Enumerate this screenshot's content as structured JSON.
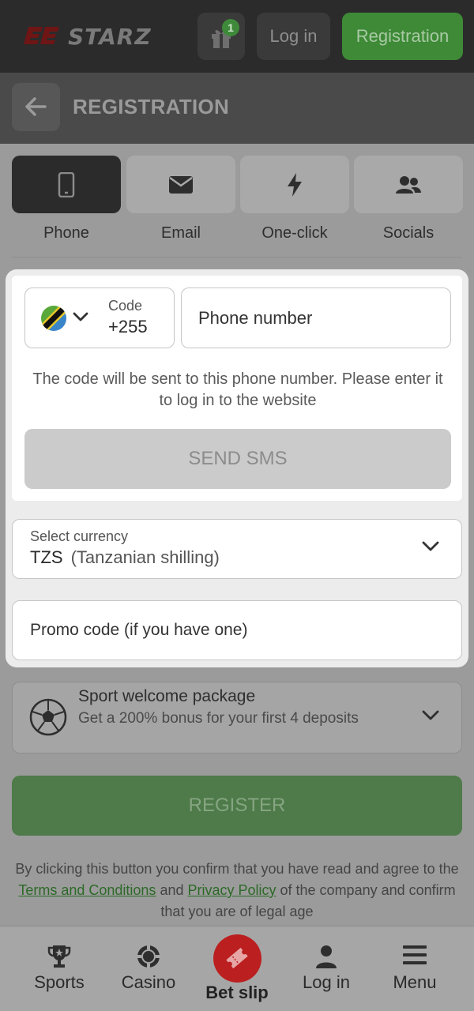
{
  "header": {
    "brand": "STARZ",
    "gift_badge": "1",
    "login_label": "Log in",
    "register_label": "Registration"
  },
  "titlebar": {
    "title": "REGISTRATION"
  },
  "tabs": [
    {
      "label": "Phone",
      "icon": "phone-icon",
      "active": true
    },
    {
      "label": "Email",
      "icon": "envelope-icon",
      "active": false
    },
    {
      "label": "One-click",
      "icon": "lightning-icon",
      "active": false
    },
    {
      "label": "Socials",
      "icon": "users-icon",
      "active": false
    }
  ],
  "phone_form": {
    "code_label": "Code",
    "code_value": "+255",
    "phone_placeholder": "Phone number",
    "hint": "The code will be sent to this phone number. Please enter it to log in to the website",
    "send_sms_label": "SEND SMS"
  },
  "currency": {
    "label": "Select currency",
    "code": "TZS",
    "name": "(Tanzanian shilling)"
  },
  "promo": {
    "placeholder": "Promo code (if you have one)"
  },
  "bonus": {
    "title": "Sport welcome package",
    "subtitle": "Get a 200% bonus for your first 4 deposits"
  },
  "register_label": "REGISTER",
  "terms": {
    "part1": "By clicking this button you confirm that you have read and agree to the ",
    "link1": "Terms and Conditions",
    "part2": " and ",
    "link2": "Privacy Policy",
    "part3": " of the company and confirm that you are of legal age"
  },
  "bottom_nav": {
    "sports": "Sports",
    "casino": "Casino",
    "betslip": "Bet slip",
    "login": "Log in",
    "menu": "Menu"
  },
  "colors": {
    "accent_green": "#3e8a37",
    "betslip_red": "#bb1f1f",
    "header_dark": "#2b2b2b"
  }
}
